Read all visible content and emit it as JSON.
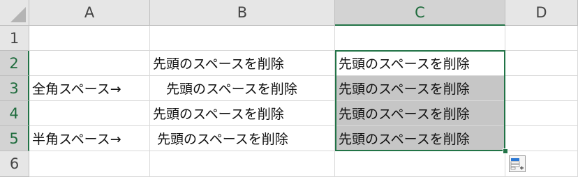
{
  "columns": [
    "A",
    "B",
    "C",
    "D"
  ],
  "rows": [
    "1",
    "2",
    "3",
    "4",
    "5",
    "6"
  ],
  "cells": {
    "A3": "全角スペース→",
    "A5": "半角スペース→",
    "B2": "先頭のスペースを削除",
    "B3": "　先頭のスペースを削除",
    "B4": "先頭のスペースを削除",
    "B5": " 先頭のスペースを削除",
    "C2": "先頭のスペースを削除",
    "C3": "先頭のスペースを削除",
    "C4": "先頭のスペースを削除",
    "C5": "先頭のスペースを削除"
  },
  "selected_column": "C",
  "selected_rows": [
    "2",
    "3",
    "4",
    "5"
  ],
  "selection_color": "#217346",
  "icons": {
    "quick_analysis": "quick-analysis-icon",
    "select_all": "select-all-corner-icon"
  }
}
